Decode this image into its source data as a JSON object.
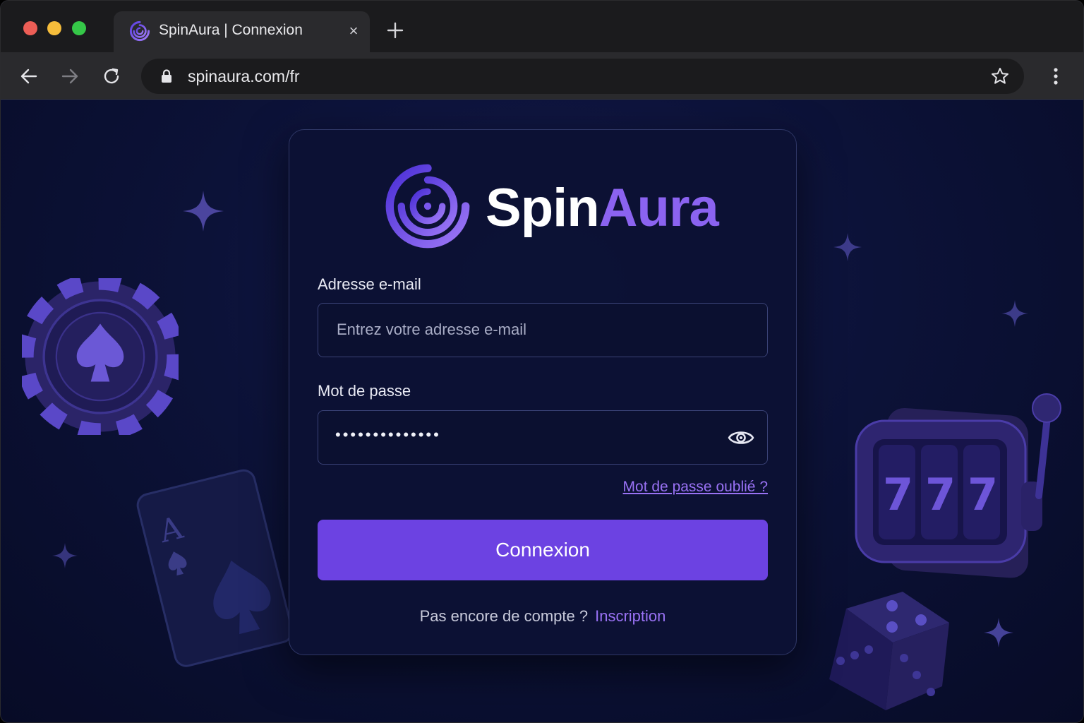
{
  "browser": {
    "tab": {
      "title": "SpinAura | Connexion",
      "close": "×"
    },
    "address_bar": {
      "url": "spinaura.com/fr"
    }
  },
  "login": {
    "brand": {
      "part1": "Spin",
      "part2": "Aura"
    },
    "email": {
      "label": "Adresse e-mail",
      "placeholder": "Entrez votre adresse e-mail"
    },
    "password": {
      "label": "Mot de passe",
      "masked_value": "••••••••••••••"
    },
    "forgot_link": "Mot de passe oublié ?",
    "submit_label": "Connexion",
    "signup_prompt": "Pas encore de compte ?",
    "signup_link": "Inscription"
  },
  "decorations": {
    "card_rank": "A",
    "slot_reels": [
      "7",
      "7",
      "7"
    ]
  },
  "colors": {
    "accent": "#6c42e2",
    "brand_purple": "#8b63f0",
    "link": "#9a72f5",
    "background": "#0c1238"
  }
}
